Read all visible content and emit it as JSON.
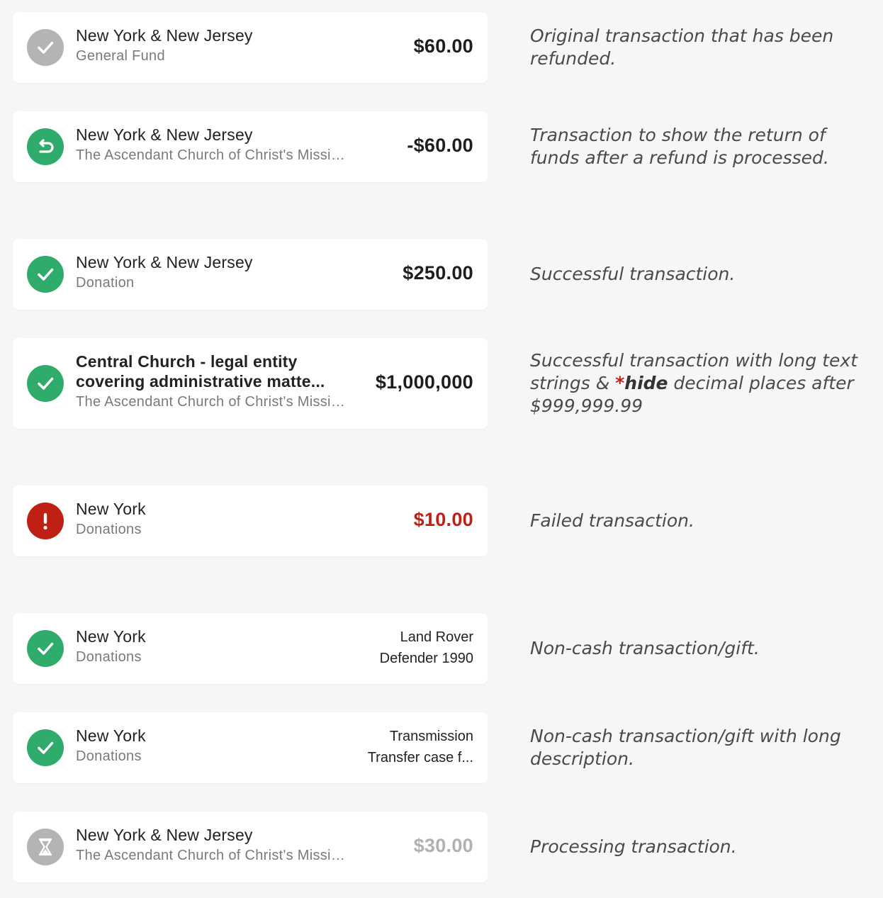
{
  "colors": {
    "background": "#f6f6f6",
    "card": "#ffffff",
    "success": "#2fab6b",
    "failed": "#c01f14",
    "muted": "#b4b4b4"
  },
  "rows": [
    {
      "status_icon": "check-gray-icon",
      "title": "New York & New Jersey",
      "subtitle": "General Fund",
      "amount": "$60.00",
      "note": "Original transaction that has been refunded."
    },
    {
      "status_icon": "refund-return-icon",
      "title": "New York & New Jersey",
      "subtitle": "The Ascendant Church of Christ's Missionaries",
      "amount": "-$60.00",
      "note": "Transaction to show the return of funds after a refund is processed."
    },
    {
      "status_icon": "check-green-icon",
      "title": "New York & New Jersey",
      "subtitle": "Donation",
      "amount": "$250.00",
      "note": "Successful transaction."
    },
    {
      "status_icon": "check-green-icon",
      "title_line1": "Central Church - legal entity",
      "title_line2": "covering administrative matte...",
      "subtitle": "The Ascendant Church of Christ's Missionaries",
      "amount": "$1,000,000",
      "note_part1": "Successful transaction with long text strings & ",
      "note_star": "*",
      "note_strong": "hide",
      "note_part2": " decimal places after $999,999.99"
    },
    {
      "status_icon": "alert-red-icon",
      "title": "New York",
      "subtitle": "Donations",
      "amount": "$10.00",
      "note": "Failed transaction."
    },
    {
      "status_icon": "check-green-icon",
      "title": "New York",
      "subtitle": "Donations",
      "item_line1": "Land Rover",
      "item_line2": "Defender 1990",
      "note": "Non-cash transaction/gift."
    },
    {
      "status_icon": "check-green-icon",
      "title": "New York",
      "subtitle": "Donations",
      "item_line1": "Transmission",
      "item_line2": "Transfer case f...",
      "note": "Non-cash transaction/gift with long description."
    },
    {
      "status_icon": "hourglass-processing-icon",
      "title": "New York & New Jersey",
      "subtitle": "The Ascendant Church of Christ's Missionaries",
      "amount": "$30.00",
      "note": "Processing transaction."
    }
  ]
}
